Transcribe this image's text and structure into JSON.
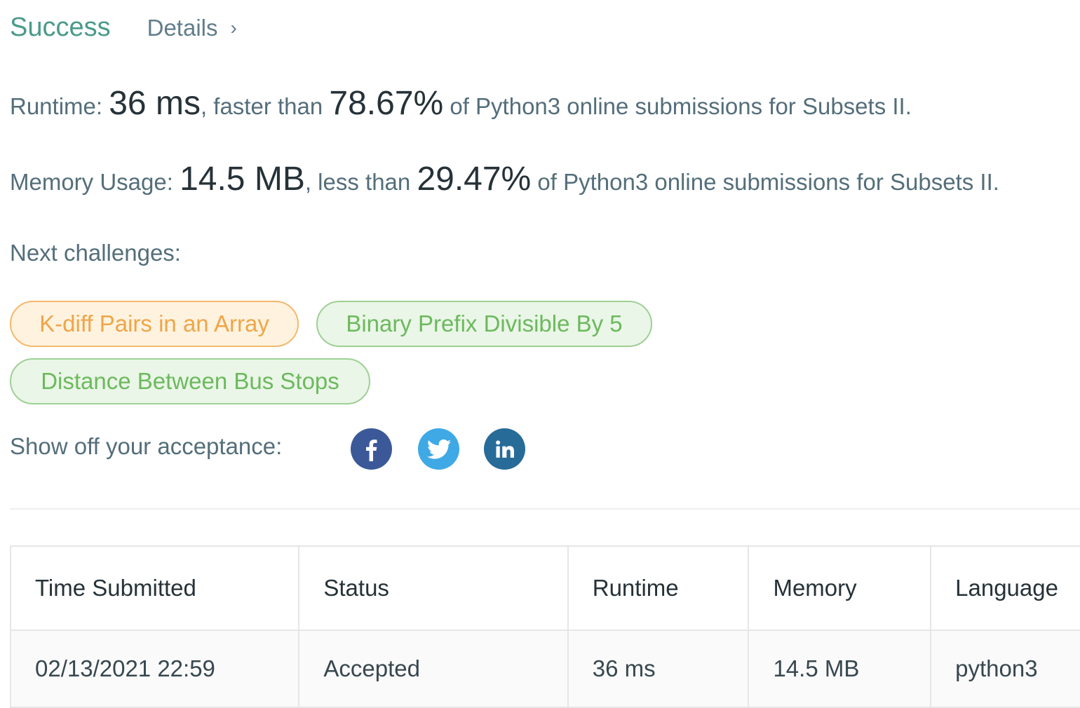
{
  "header": {
    "status": "Success",
    "details_label": "Details",
    "details_chevron": "›"
  },
  "runtime": {
    "label": "Runtime:",
    "value": "36 ms",
    "comparison": ", faster than ",
    "percent": "78.67%",
    "suffix": " of Python3 online submissions for Subsets II."
  },
  "memory": {
    "label": "Memory Usage:",
    "value": "14.5 MB",
    "comparison": ", less than ",
    "percent": "29.47%",
    "suffix": " of Python3 online submissions for Subsets II."
  },
  "next_challenges": {
    "label": "Next challenges:",
    "items": [
      {
        "title": "K-diff Pairs in an Array",
        "difficulty": "medium"
      },
      {
        "title": "Binary Prefix Divisible By 5",
        "difficulty": "easy"
      },
      {
        "title": "Distance Between Bus Stops",
        "difficulty": "easy"
      }
    ]
  },
  "share": {
    "label": "Show off your acceptance:",
    "icons": [
      "facebook-icon",
      "twitter-icon",
      "linkedin-icon"
    ]
  },
  "table": {
    "headers": [
      "Time Submitted",
      "Status",
      "Runtime",
      "Memory",
      "Language"
    ],
    "rows": [
      [
        "02/13/2021 22:59",
        "Accepted",
        "36 ms",
        "14.5 MB",
        "python3"
      ]
    ]
  },
  "colors": {
    "success": "#4a9a8a",
    "medium": "#f0a548",
    "easy": "#6cb95e",
    "facebook": "#3b5998",
    "twitter": "#3fa9e6",
    "linkedin": "#276b99"
  }
}
